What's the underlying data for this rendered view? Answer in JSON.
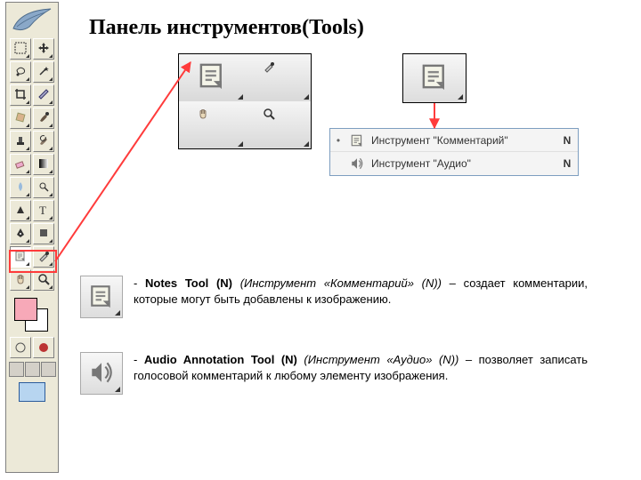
{
  "heading": {
    "part1": "Панель инструментов",
    "part2_paren_open": "(",
    "part2_text": "Tools",
    "part2_paren_close": ")"
  },
  "toolbox_tools": [
    {
      "name": "marquee-rect",
      "glyph": "selection"
    },
    {
      "name": "move",
      "glyph": "move"
    },
    {
      "name": "lasso",
      "glyph": "lasso"
    },
    {
      "name": "magic-wand",
      "glyph": "wand"
    },
    {
      "name": "crop",
      "glyph": "crop"
    },
    {
      "name": "slice",
      "glyph": "slice"
    },
    {
      "name": "healing-brush",
      "glyph": "heal"
    },
    {
      "name": "brush",
      "glyph": "brush"
    },
    {
      "name": "clone-stamp",
      "glyph": "stamp"
    },
    {
      "name": "history-brush",
      "glyph": "history"
    },
    {
      "name": "eraser",
      "glyph": "eraser"
    },
    {
      "name": "gradient",
      "glyph": "gradient"
    },
    {
      "name": "blur",
      "glyph": "blur"
    },
    {
      "name": "dodge",
      "glyph": "dodge"
    },
    {
      "name": "path-select",
      "glyph": "path"
    },
    {
      "name": "type",
      "glyph": "type"
    },
    {
      "name": "pen",
      "glyph": "pen"
    },
    {
      "name": "shape",
      "glyph": "shape"
    },
    {
      "name": "notes",
      "glyph": "note",
      "selected": true
    },
    {
      "name": "eyedropper",
      "glyph": "eyedrop"
    },
    {
      "name": "hand",
      "glyph": "hand"
    },
    {
      "name": "zoom",
      "glyph": "zoom"
    }
  ],
  "big_group": [
    {
      "name": "notes-big",
      "glyph": "note"
    },
    {
      "name": "eyedropper-big",
      "glyph": "eyedrop"
    },
    {
      "name": "hand-big",
      "glyph": "hand"
    },
    {
      "name": "zoom-big",
      "glyph": "zoom"
    }
  ],
  "big_single": {
    "name": "notes-single",
    "glyph": "note"
  },
  "flyout": {
    "items": [
      {
        "dot": "•",
        "icon": "note",
        "label": "Инструмент \"Комментарий\"",
        "key": "N",
        "name": "fly-notes"
      },
      {
        "dot": "",
        "icon": "audio",
        "label": "Инструмент \"Аудио\"",
        "key": "N",
        "name": "fly-audio"
      }
    ]
  },
  "descriptions": {
    "notes": {
      "lead": " - ",
      "bold": "Notes Tool (N)",
      "italic": " (Инструмент «Комментарий» (N))",
      "tail": " – создает комментарии, которые могут быть добавлены к изображению."
    },
    "audio": {
      "lead": " - ",
      "bold": "Audio Annotation Tool (N)",
      "italic": " (Инструмент «Аудио» (N))",
      "tail": " – позволяет записать голосовой комментарий к любому элементу изображения."
    }
  },
  "swatch": {
    "fg": "#f7a9b8",
    "bg": "#ffffff"
  }
}
